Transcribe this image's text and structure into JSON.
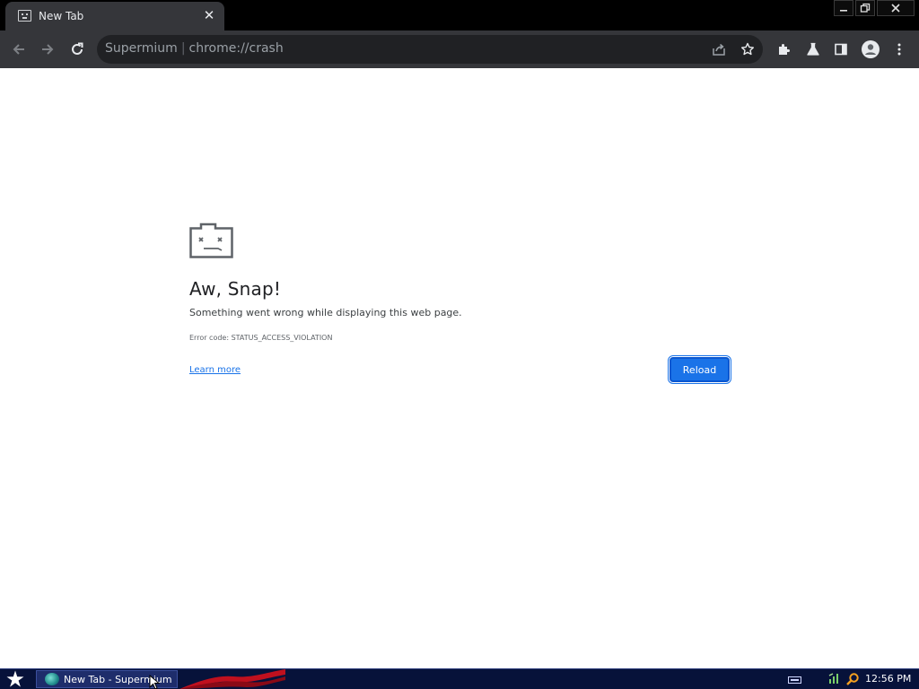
{
  "tab": {
    "title": "New Tab",
    "close_symbol": "✕"
  },
  "window_controls": {
    "minimize": "—",
    "maximize": "⧉",
    "close": "✕"
  },
  "omnibox": {
    "site_name": "Supermium",
    "url": "chrome://crash"
  },
  "crash_page": {
    "heading": "Aw, Snap!",
    "message": "Something went wrong while displaying this web page.",
    "error_code": "Error code: STATUS_ACCESS_VIOLATION",
    "learn_more": "Learn more",
    "reload": "Reload"
  },
  "taskbar": {
    "task_label": "New Tab - Supermium",
    "clock": "12:56 PM"
  },
  "icons": {
    "back": "back-arrow-icon",
    "forward": "forward-arrow-icon",
    "reload": "reload-icon",
    "share": "share-icon",
    "bookmark": "star-icon",
    "extensions": "puzzle-icon",
    "labs": "flask-icon",
    "side_panel": "side-panel-icon",
    "profile": "profile-icon",
    "menu": "kebab-menu-icon"
  },
  "colors": {
    "toolbar": "#35363a",
    "omnibox": "#202124",
    "accent": "#1a73e8",
    "taskbar": "#07123a"
  }
}
